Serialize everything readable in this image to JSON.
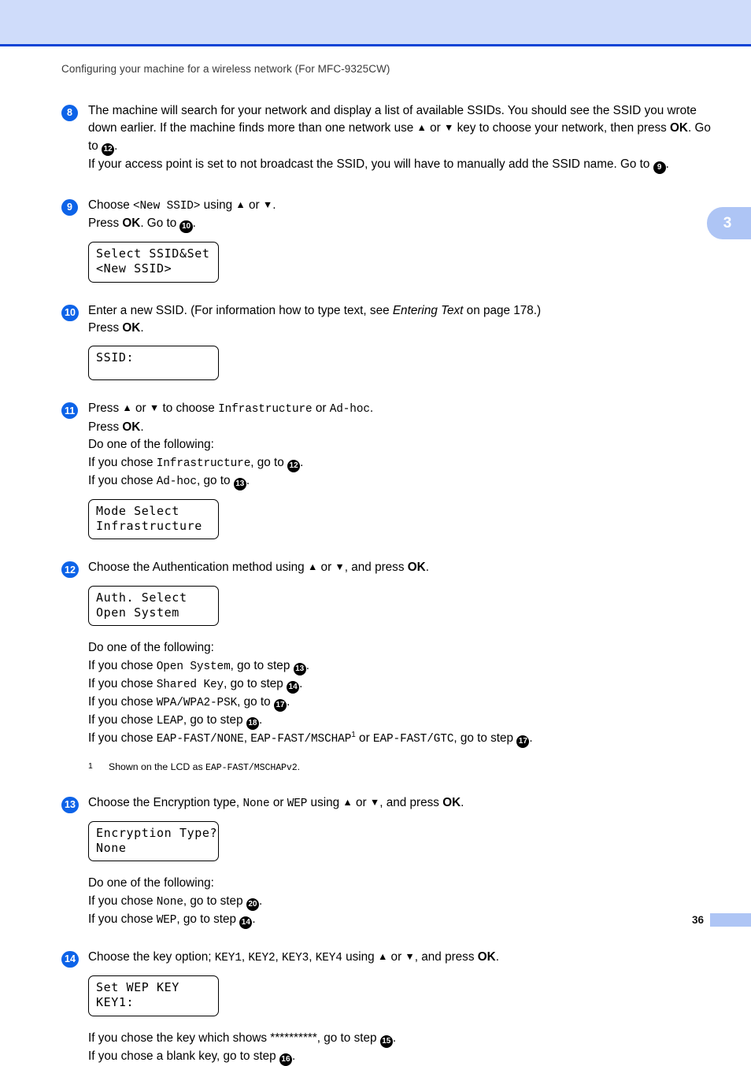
{
  "header": {
    "running_title": "Configuring your machine for a wireless network (For MFC-9325CW)"
  },
  "chapter_tab": {
    "number": "3",
    "color": "#aec5f5"
  },
  "footer": {
    "page_number": "36",
    "bar_color": "#aec5f5"
  },
  "colors": {
    "band": "#cfdcfa",
    "rule": "#0b43d6",
    "badge": "#0d63e8",
    "ref": "#000000"
  },
  "steps": {
    "s8": {
      "badge": "8",
      "p1_a": "The machine will search for your network and display a list of available SSIDs. You should see the SSID you wrote down earlier. If the machine finds more than one network use ",
      "p1_up": "▲",
      "p1_b": " or ",
      "p1_down": "▼",
      "p1_c": " key to choose your network, then press ",
      "p1_ok": "OK",
      "p1_d": ". Go to ",
      "p1_ref": "12",
      "p1_e": ".",
      "p2_a": "If your access point is set to not broadcast the SSID, you will have to manually add the SSID name. Go to ",
      "p2_ref": "9",
      "p2_b": "."
    },
    "s9": {
      "badge": "9",
      "l1_a": "Choose ",
      "l1_mono": "<New SSID>",
      "l1_b": " using ",
      "l1_up": "▲",
      "l1_c": " or ",
      "l1_down": "▼",
      "l1_d": ".",
      "l2_a": "Press ",
      "l2_ok": "OK",
      "l2_b": ". Go to ",
      "l2_ref": "10",
      "l2_c": ".",
      "lcd_line1": "Select SSID&Set",
      "lcd_line2": "<New SSID>"
    },
    "s10": {
      "badge": "10",
      "l1_a": "Enter a new SSID. (For information how to type text, see ",
      "l1_ital": "Entering Text",
      "l1_b": " on page 178.)",
      "l2_a": "Press ",
      "l2_ok": "OK",
      "l2_b": ".",
      "lcd_line1": "SSID:",
      "lcd_line2": ""
    },
    "s11": {
      "badge": "11",
      "l1_a": "Press ",
      "l1_up": "▲",
      "l1_b": " or ",
      "l1_down": "▼",
      "l1_c": " to choose ",
      "l1_m1": "Infrastructure",
      "l1_d": " or ",
      "l1_m2": "Ad-hoc",
      "l1_e": ".",
      "l2_a": "Press ",
      "l2_ok": "OK",
      "l2_b": ".",
      "l3": "Do one of the following:",
      "l4_a": "If you chose ",
      "l4_m": "Infrastructure",
      "l4_b": ", go to ",
      "l4_ref": "12",
      "l4_c": ".",
      "l5_a": "If you chose ",
      "l5_m": "Ad-hoc",
      "l5_b": ", go to ",
      "l5_ref": "13",
      "l5_c": ".",
      "lcd_line1": "Mode Select",
      "lcd_line2": "Infrastructure"
    },
    "s12": {
      "badge": "12",
      "l1_a": "Choose the Authentication method using ",
      "l1_up": "▲",
      "l1_b": " or ",
      "l1_down": "▼",
      "l1_c": ", and press ",
      "l1_ok": "OK",
      "l1_d": ".",
      "lcd_line1": "Auth. Select",
      "lcd_line2": "Open System",
      "l2": "Do one of the following:",
      "l3_a": "If you chose ",
      "l3_m": "Open System",
      "l3_b": ", go to step ",
      "l3_ref": "13",
      "l3_c": ".",
      "l4_a": "If you chose ",
      "l4_m": "Shared Key",
      "l4_b": ", go to step ",
      "l4_ref": "14",
      "l4_c": ".",
      "l5_a": "If you chose ",
      "l5_m": "WPA/WPA2-PSK",
      "l5_b": ", go to ",
      "l5_ref": "17",
      "l5_c": ".",
      "l6_a": "If you chose ",
      "l6_m": "LEAP",
      "l6_b": ", go to step ",
      "l6_ref": "18",
      "l6_c": ".",
      "l7_a": "If you chose ",
      "l7_m1": "EAP-FAST/NONE",
      "l7_b": ", ",
      "l7_m2": "EAP-FAST/MSCHAP",
      "l7_sup": "1",
      "l7_c": " or ",
      "l7_m3": "EAP-FAST/GTC",
      "l7_d": ", go to step ",
      "l7_ref": "17",
      "l7_e": ".",
      "footnote_mark": "1",
      "footnote_a": "Shown on the LCD as ",
      "footnote_m": "EAP-FAST/MSCHAPv2",
      "footnote_b": "."
    },
    "s13": {
      "badge": "13",
      "l1_a": "Choose the Encryption type, ",
      "l1_m1": "None",
      "l1_b": " or ",
      "l1_m2": "WEP",
      "l1_c": " using ",
      "l1_up": "▲",
      "l1_d": " or ",
      "l1_down": "▼",
      "l1_e": ", and press ",
      "l1_ok": "OK",
      "l1_f": ".",
      "lcd_line1": "Encryption Type?",
      "lcd_line2": "None",
      "l2": "Do one of the following:",
      "l3_a": "If you chose ",
      "l3_m": "None",
      "l3_b": ", go to step ",
      "l3_ref": "20",
      "l3_c": ".",
      "l4_a": "If you chose ",
      "l4_m": "WEP",
      "l4_b": ", go to step ",
      "l4_ref": "14",
      "l4_c": "."
    },
    "s14": {
      "badge": "14",
      "l1_a": "Choose the key option; ",
      "l1_m1": "KEY1",
      "l1_b": ", ",
      "l1_m2": "KEY2",
      "l1_c": ", ",
      "l1_m3": "KEY3",
      "l1_d": ", ",
      "l1_m4": "KEY4",
      "l1_e": " using ",
      "l1_up": "▲",
      "l1_f": " or ",
      "l1_down": "▼",
      "l1_g": ", and press ",
      "l1_ok": "OK",
      "l1_h": ".",
      "lcd_line1": "Set WEP KEY",
      "lcd_line2": "KEY1:",
      "l2_a": "If you chose the key which shows **********, go to step ",
      "l2_ref": "15",
      "l2_b": ".",
      "l3_a": "If you chose a blank key, go to step ",
      "l3_ref": "16",
      "l3_b": "."
    }
  }
}
